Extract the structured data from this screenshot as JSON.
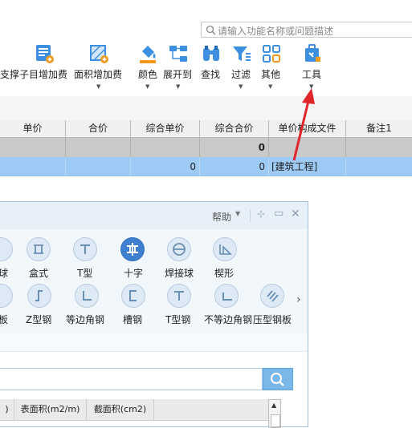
{
  "search": {
    "placeholder": "请输入功能名称或问题描述"
  },
  "ribbon": {
    "items": [
      {
        "label": "支撑"
      },
      {
        "label": "子目增加费"
      },
      {
        "label": "面积增加费"
      },
      {
        "label": "颜色"
      },
      {
        "label": "展开到"
      },
      {
        "label": "查找"
      },
      {
        "label": "过滤"
      },
      {
        "label": "其他"
      },
      {
        "label": "工具"
      }
    ]
  },
  "grid": {
    "headers": [
      "单价",
      "合价",
      "综合单价",
      "综合合价",
      "单价构成文件",
      "备注1"
    ],
    "row1": {
      "col_total": "0"
    },
    "row2": {
      "unit": "0",
      "total": "0",
      "file": "[建筑工程]"
    }
  },
  "dialog": {
    "help": "帮助",
    "shapes_row1": [
      "球",
      "盒式",
      "T型",
      "十字",
      "焊接球",
      "楔形"
    ],
    "shapes_row2": [
      "板",
      "Z型钢",
      "等边角钢",
      "槽钢",
      "T型钢",
      "不等边角钢",
      "压型钢板"
    ],
    "selected_shape": "十字",
    "table_headers": [
      ")",
      "表面积(m2/m)",
      "截面积(cm2)"
    ]
  },
  "colors": {
    "accent_blue": "#3f7fd0",
    "selected_row": "#9ecbf5",
    "arrow_red": "#e0262a"
  }
}
